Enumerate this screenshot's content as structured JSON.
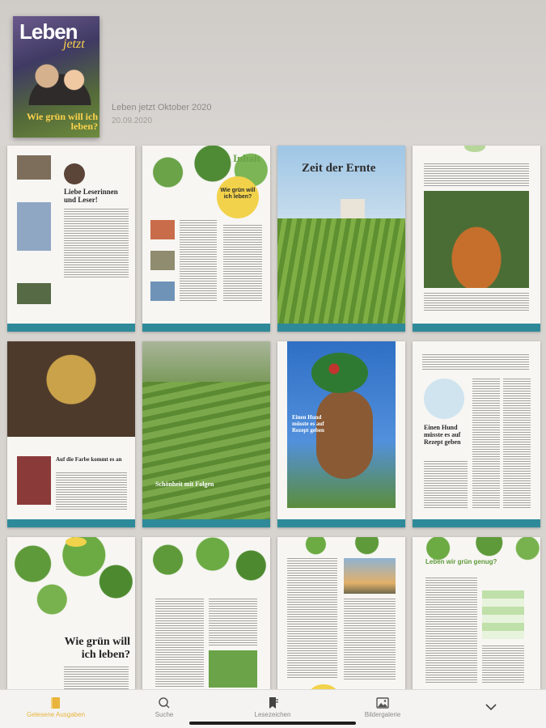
{
  "issue": {
    "title": "Leben jetzt Oktober 2020",
    "date": "20.09.2020",
    "cover_logo": "Leben",
    "cover_logo_sub": "jetzt",
    "cover_headline": "Wie grün will ich leben?"
  },
  "pages": [
    {
      "headline": "Liebe Leserinnen und Leser!"
    },
    {
      "headline": "Inhalt",
      "badge": "Wie grün will ich leben?"
    },
    {
      "headline": "Zeit der Ernte"
    },
    {
      "headline": ""
    },
    {
      "headline": "Auf die Farbe kommt es an"
    },
    {
      "headline": "Schönheit mit Folgen"
    },
    {
      "headline": "Einen Hund müsste es auf Rezept geben"
    },
    {
      "headline": ""
    },
    {
      "headline": "Wie grün will ich leben?"
    },
    {
      "headline": ""
    },
    {
      "headline": ""
    },
    {
      "headline": "Leben wir grün genug?"
    }
  ],
  "tabs": [
    {
      "label": "Gelesene Ausgaben",
      "icon": "book-icon",
      "active": true
    },
    {
      "label": "Suche",
      "icon": "search-icon",
      "active": false
    },
    {
      "label": "Lesezeichen",
      "icon": "bookmark-icon",
      "active": false
    },
    {
      "label": "Bildergalerie",
      "icon": "gallery-icon",
      "active": false
    }
  ],
  "colors": {
    "accent": "#e8b43b",
    "teal": "#2e8a99",
    "leaf_green": "#5f9a3a"
  }
}
